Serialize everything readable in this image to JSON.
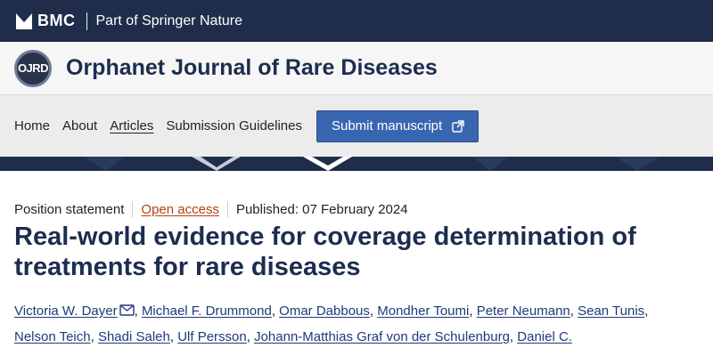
{
  "topbar": {
    "brand": "BMC",
    "tagline": "Part of Springer Nature"
  },
  "journal": {
    "logo_text": "OJRD",
    "title": "Orphanet Journal of Rare Diseases"
  },
  "nav": {
    "items": [
      "Home",
      "About",
      "Articles",
      "Submission Guidelines"
    ],
    "active": "Articles",
    "submit_label": "Submit manuscript"
  },
  "article": {
    "type": "Position statement",
    "access": "Open access",
    "published": "Published: 07 February 2024",
    "title": "Real-world evidence for coverage determination of treatments for rare diseases",
    "authors": [
      "Victoria W. Dayer",
      "Michael F. Drummond",
      "Omar Dabbous",
      "Mondher Toumi",
      "Peter Neumann",
      "Sean Tunis",
      "Nelson Teich",
      "Shadi Saleh",
      "Ulf Persson",
      "Johann-Matthias Graf von der Schulenburg",
      "Daniel C."
    ]
  },
  "colors": {
    "navy": "#1f2d4a",
    "title_navy": "#1d2d4f",
    "button_blue": "#3966b1",
    "open_access": "#b7410e"
  }
}
